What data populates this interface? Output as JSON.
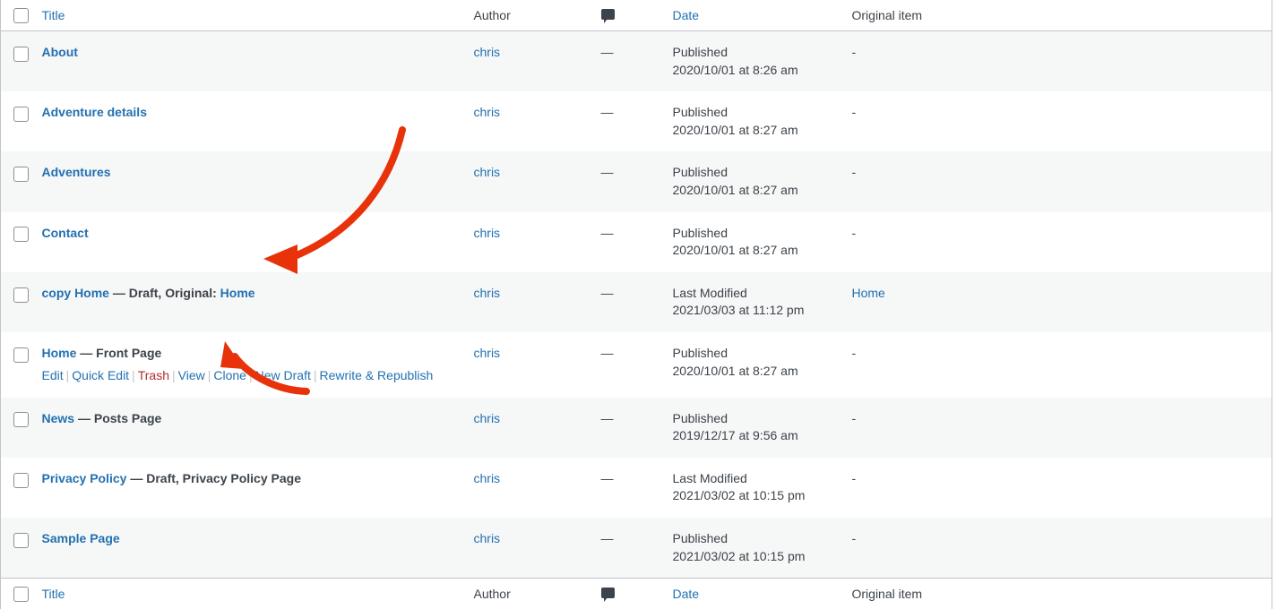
{
  "table": {
    "columns": {
      "checkbox_label": "select-all",
      "title": "Title",
      "author": "Author",
      "comments_icon": "comment-bubble-icon",
      "date": "Date",
      "original_item": "Original item"
    },
    "rows": [
      {
        "title": "About",
        "suffix": "",
        "original_link_text": "",
        "author": "chris",
        "comments": "—",
        "date_status": "Published",
        "date_value": "2020/10/01 at 8:26 am",
        "original_item": "-",
        "original_item_is_link": false,
        "striped": true,
        "actions": []
      },
      {
        "title": "Adventure details",
        "suffix": "",
        "original_link_text": "",
        "author": "chris",
        "comments": "—",
        "date_status": "Published",
        "date_value": "2020/10/01 at 8:27 am",
        "original_item": "-",
        "original_item_is_link": false,
        "striped": false,
        "actions": []
      },
      {
        "title": "Adventures",
        "suffix": "",
        "original_link_text": "",
        "author": "chris",
        "comments": "—",
        "date_status": "Published",
        "date_value": "2020/10/01 at 8:27 am",
        "original_item": "-",
        "original_item_is_link": false,
        "striped": true,
        "actions": []
      },
      {
        "title": "Contact",
        "suffix": "",
        "original_link_text": "",
        "author": "chris",
        "comments": "—",
        "date_status": "Published",
        "date_value": "2020/10/01 at 8:27 am",
        "original_item": "-",
        "original_item_is_link": false,
        "striped": false,
        "actions": []
      },
      {
        "title": "copy Home",
        "suffix": " — Draft, Original: ",
        "original_link_text": "Home",
        "author": "chris",
        "comments": "—",
        "date_status": "Last Modified",
        "date_value": "2021/03/03 at 11:12 pm",
        "original_item": "Home",
        "original_item_is_link": true,
        "striped": true,
        "actions": []
      },
      {
        "title": "Home",
        "suffix": " — Front Page",
        "original_link_text": "",
        "author": "chris",
        "comments": "—",
        "date_status": "Published",
        "date_value": "2020/10/01 at 8:27 am",
        "original_item": "-",
        "original_item_is_link": false,
        "striped": false,
        "actions": [
          {
            "label": "Edit",
            "kind": "edit"
          },
          {
            "label": "Quick Edit",
            "kind": "quick-edit"
          },
          {
            "label": "Trash",
            "kind": "trash"
          },
          {
            "label": "View",
            "kind": "view"
          },
          {
            "label": "Clone",
            "kind": "clone"
          },
          {
            "label": "New Draft",
            "kind": "new-draft"
          },
          {
            "label": "Rewrite & Republish",
            "kind": "rewrite-republish"
          }
        ]
      },
      {
        "title": "News",
        "suffix": " — Posts Page",
        "original_link_text": "",
        "author": "chris",
        "comments": "—",
        "date_status": "Published",
        "date_value": "2019/12/17 at 9:56 am",
        "original_item": "-",
        "original_item_is_link": false,
        "striped": true,
        "actions": []
      },
      {
        "title": "Privacy Policy",
        "suffix": " — Draft, Privacy Policy Page",
        "original_link_text": "",
        "author": "chris",
        "comments": "—",
        "date_status": "Last Modified",
        "date_value": "2021/03/02 at 10:15 pm",
        "original_item": "-",
        "original_item_is_link": false,
        "striped": false,
        "actions": []
      },
      {
        "title": "Sample Page",
        "suffix": "",
        "original_link_text": "",
        "author": "chris",
        "comments": "—",
        "date_status": "Published",
        "date_value": "2021/03/02 at 10:15 pm",
        "original_item": "-",
        "original_item_is_link": false,
        "striped": true,
        "actions": []
      }
    ]
  },
  "annotations": {
    "arrow_color": "#e8320a",
    "arrows": [
      {
        "name": "arrow-to-original-home-link",
        "points_at": "copy Home — Draft, Original: Home"
      },
      {
        "name": "arrow-to-clone-action",
        "points_at": "Clone"
      }
    ]
  },
  "colors": {
    "link": "#2271b1",
    "text": "#3c434a",
    "trash": "#b32d2e",
    "stripe": "#f6f7f7",
    "border": "#c3c4c7",
    "accent_red": "#e8320a"
  }
}
